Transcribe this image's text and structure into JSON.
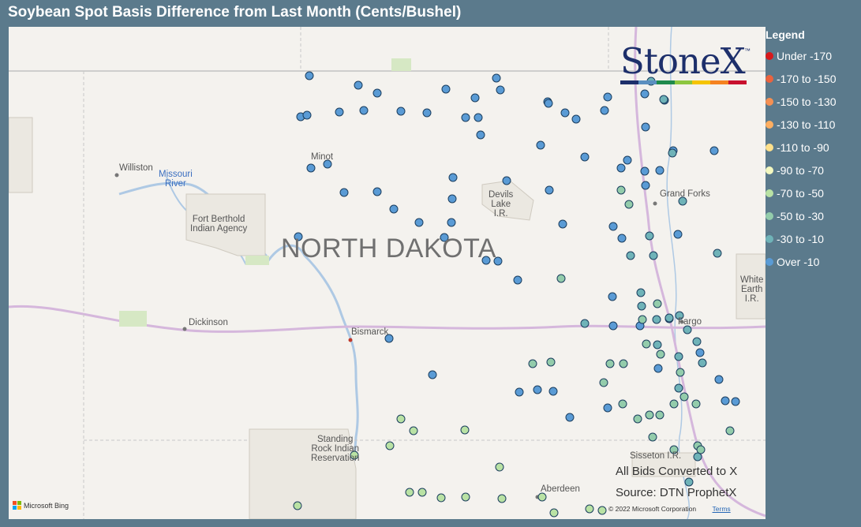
{
  "title": "Soybean Spot Basis Difference from Last Month (Cents/Bushel)",
  "map": {
    "state_label": "NORTH DAKOTA",
    "labels": {
      "williston": "Williston",
      "missouri_river": "Missouri\nRiver",
      "fort_berthold": "Fort Berthold\nIndian Agency",
      "minot": "Minot",
      "devils_lake": "Devils\nLake\nI.R.",
      "grand_forks": "Grand Forks",
      "white_earth": "White\nEarth\nI.R.",
      "dickinson": "Dickinson",
      "bismarck": "Bismarck",
      "fargo": "Fargo",
      "standing_rock": "Standing\nRock Indian\nReservation",
      "sisseton": "Sisseton I.R.",
      "aberdeen": "Aberdeen"
    },
    "attribution": {
      "bing": "Microsoft Bing",
      "copyright": "© 2022 Microsoft Corporation",
      "terms": "Terms"
    }
  },
  "logo": {
    "text": "StoneX",
    "tm": "™",
    "bar_colors": [
      "#1d2f6b",
      "#5b8fc0",
      "#1f8a4c",
      "#8cc63f",
      "#f5c400",
      "#f58220",
      "#c8102e"
    ]
  },
  "source": {
    "line1": "All Bids Converted to X",
    "line2": "Source: DTN ProphetX"
  },
  "legend": {
    "title": "Legend",
    "items": [
      {
        "label": "Under -170",
        "color": "#d7191c"
      },
      {
        "label": "-170 to -150",
        "color": "#ea633e"
      },
      {
        "label": "-150 to -130",
        "color": "#f59053"
      },
      {
        "label": "-130 to -110",
        "color": "#fdae61"
      },
      {
        "label": "-110 to -90",
        "color": "#fee08b"
      },
      {
        "label": "-90 to -70",
        "color": "#f3f8c0"
      },
      {
        "label": "-70 to -50",
        "color": "#b9e2a4"
      },
      {
        "label": "-50 to -30",
        "color": "#93ccab"
      },
      {
        "label": "-30 to -10",
        "color": "#6fb3b8"
      },
      {
        "label": "Over -10",
        "color": "#5a9bd5"
      }
    ]
  },
  "bid_points": {
    "Over -10": 70,
    "-30 to -10": 22,
    "-50 to -30": 25,
    "-70 to -50": 16
  }
}
